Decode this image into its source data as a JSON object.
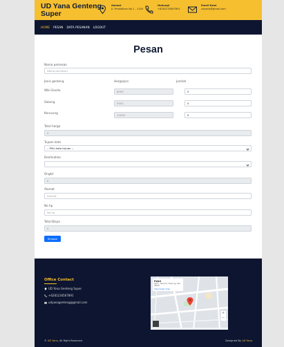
{
  "header": {
    "brand": "UD Yana Genteng Super",
    "info": [
      {
        "title": "Alamat",
        "text": "Jl. Pendidikan No.1 - 1100",
        "icon": "location-icon"
      },
      {
        "title": "Hubungi",
        "text": "+6281234567891",
        "icon": "phone-icon"
      },
      {
        "title": "Email Kami",
        "text": "udyana@gmail.com",
        "icon": "email-icon"
      }
    ]
  },
  "nav": [
    {
      "label": "Home",
      "active": true
    },
    {
      "label": "Pesan",
      "active": false
    },
    {
      "label": "Data Pesanan",
      "active": false
    },
    {
      "label": "Logout",
      "active": false
    }
  ],
  "form": {
    "title": "Pesan",
    "nama_label": "Nama pemesan",
    "nama_placeholder": "Nama pemesan",
    "col_jenis": "Jenis genteng",
    "col_harga": "Harga/pcs",
    "col_jumlah": "Jumlah",
    "items": [
      {
        "name": "Wiki Goolio",
        "price": "8000",
        "qty": "0"
      },
      {
        "name": "Sokong",
        "price": "5500",
        "qty": "0"
      },
      {
        "name": "Kerucung",
        "price": "10000",
        "qty": "0"
      }
    ],
    "total_label": "Total harga",
    "total_value": "0",
    "tujuan_label": "Tujuan kota",
    "tujuan_value": "-- Pilih kota tujuan --",
    "destination_label": "Destination",
    "destination_value": "",
    "ongkir_label": "Ongkir",
    "ongkir_value": "0",
    "alamat_label": "Alamat",
    "alamat_placeholder": "Alamat",
    "nohp_label": "No hp",
    "nohp_placeholder": "No hp",
    "biaya_label": "Total Biaya",
    "biaya_value": "0",
    "submit_label": "Simpan"
  },
  "footer": {
    "title": "Office Contact",
    "address": "UD Yana Genteng Super",
    "phone": "+6281234567891",
    "email": "udyanagenteng@gmail.com",
    "map_card": {
      "name": "Fahri",
      "address": "Jalan, Temera, Tanjung, Kec. ABCD",
      "link": "View larger map"
    },
    "copyright_brand": "UD Yana",
    "copyright_text": "All Right Reserved",
    "design_text": "Designed By",
    "design_brand": "UD Yana"
  },
  "colors": {
    "accent": "#f6bf2f",
    "navy": "#0d1530",
    "primary": "#0d6efd"
  }
}
